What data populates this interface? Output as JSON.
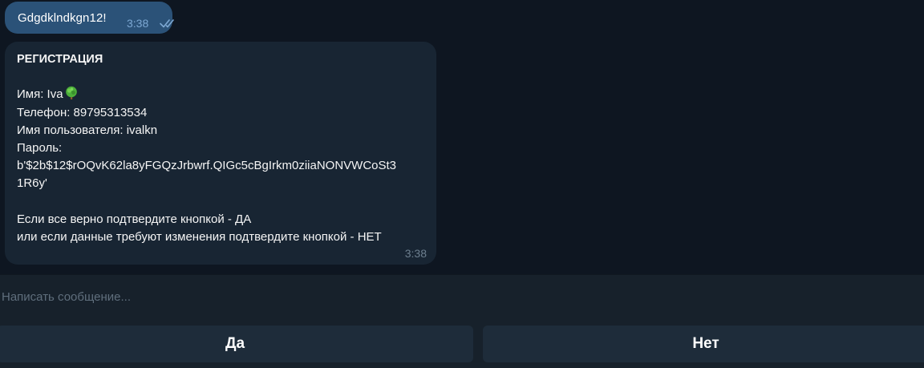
{
  "messages": {
    "outgoing": {
      "text": "Gdgdklndkgn12!",
      "time": "3:38",
      "status_icon": "double-check-icon"
    },
    "incoming": {
      "title": "РЕГИСТРАЦИЯ",
      "name_line": "Имя: Iva",
      "name_emoji": "tree-emoji",
      "phone_line": "Телефон: 89795313534",
      "username_line": "Имя пользователя: ivalkn",
      "password_label": "Пароль:",
      "password_line1": "b'$2b$12$rOQvK62la8yFGQzJrbwrf.QIGc5cBgIrkm0ziiaNONVWCoSt3",
      "password_line2": "1R6y'",
      "confirm_yes_line": "Если все верно подтвердите кнопкой  - ДА",
      "confirm_no_line": "или если данные требуют изменения подтвердите кнопкой - НЕТ",
      "time": "3:38"
    }
  },
  "composer": {
    "placeholder": "Написать сообщение..."
  },
  "keyboard": {
    "yes_label": "Да",
    "no_label": "Нет"
  },
  "colors": {
    "background": "#0e1621",
    "outgoing_bubble": "#2b5278",
    "incoming_bubble": "#182533",
    "panel": "#17212b",
    "button": "#1e2c3a"
  }
}
